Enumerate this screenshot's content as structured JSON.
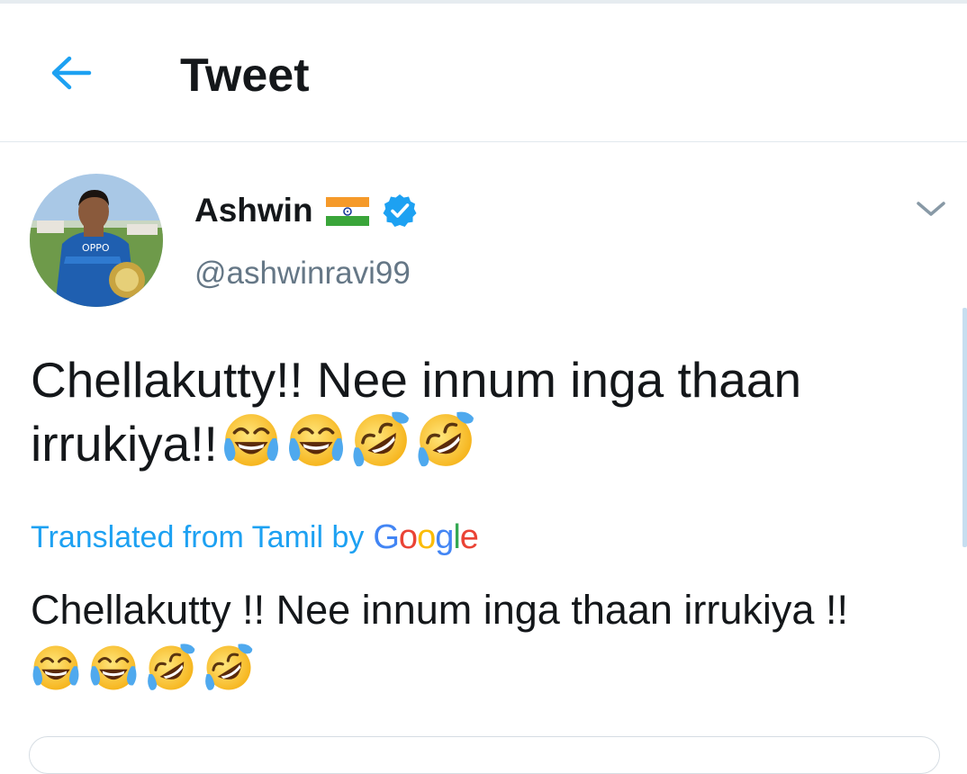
{
  "header": {
    "back_icon": "arrow-left-icon",
    "title": "Tweet"
  },
  "tweet": {
    "author": {
      "name": "Ashwin",
      "handle": "@ashwinravi99",
      "flag_icon": "india-flag-icon",
      "verified_icon": "verified-badge-icon"
    },
    "menu_icon": "chevron-down-icon",
    "text": "Chellakutty!! Nee innum inga thaan irrukiya!!",
    "emojis": [
      "face-with-tears-of-joy",
      "face-with-tears-of-joy",
      "rolling-on-the-floor-laughing",
      "rolling-on-the-floor-laughing"
    ],
    "translation_label": "Translated from Tamil by",
    "translation_provider": "Google",
    "translation_text": "Chellakutty !! Nee innum inga thaan irrukiya !!"
  },
  "colors": {
    "accent": "#1da1f2",
    "secondary_text": "#657786",
    "divider": "#e1e8ed"
  }
}
